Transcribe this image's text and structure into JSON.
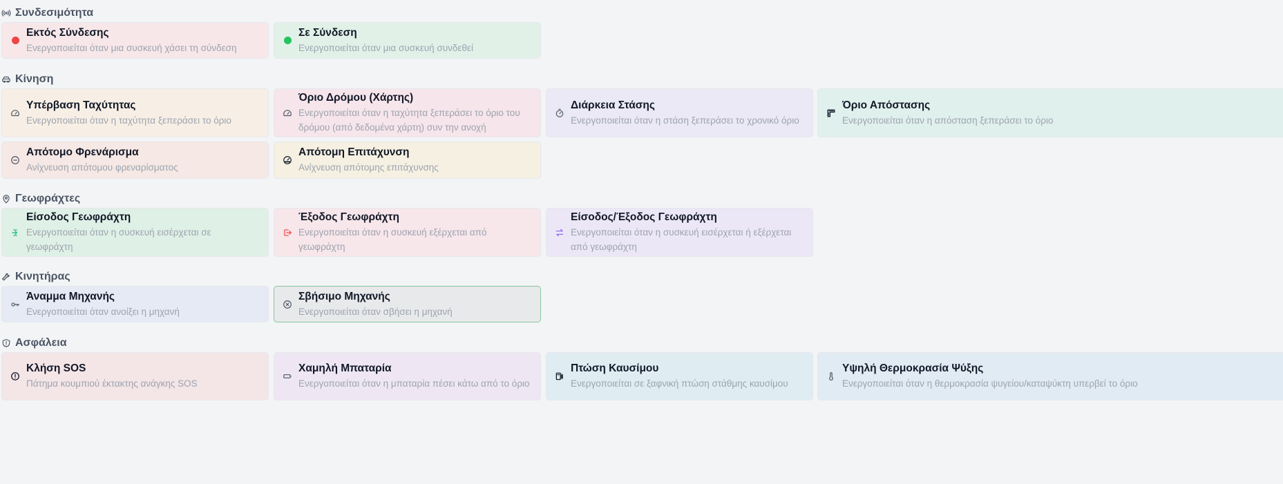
{
  "sections": [
    {
      "id": "connectivity",
      "title": "Συνδεσιμότητα",
      "icon": "signal-icon",
      "cards": [
        {
          "title": "Εκτός Σύνδεσης",
          "desc": "Ενεργοποιείται όταν μια συσκευή χάσει τη σύνδεση",
          "icon": "offline-dot-icon",
          "color": "#ef4444"
        },
        {
          "title": "Σε Σύνδεση",
          "desc": "Ενεργοποιείται όταν μια συσκευή συνδεθεί",
          "icon": "online-dot-icon",
          "color": "#22c55e"
        }
      ]
    },
    {
      "id": "motion",
      "title": "Κίνηση",
      "icon": "car-icon",
      "cards": [
        {
          "title": "Υπέρβαση Ταχύτητας",
          "desc": "Ενεργοποιείται όταν η ταχύτητα ξεπεράσει το όριο",
          "icon": "speedometer-icon"
        },
        {
          "title": "Όριο Δρόμου (Χάρτης)",
          "desc": "Ενεργοποιείται όταν η ταχύτητα ξεπεράσει το όριο του δρόμου (από δεδομένα χάρτη) συν την ανοχή",
          "icon": "speedometer-icon"
        },
        {
          "title": "Διάρκεια Στάσης",
          "desc": "Ενεργοποιείται όταν η στάση ξεπεράσει το χρονικό όριο",
          "icon": "stopwatch-icon"
        },
        {
          "title": "Όριο Απόστασης",
          "desc": "Ενεργοποιείται όταν η απόσταση ξεπεράσει το όριο",
          "icon": "ruler-icon"
        },
        {
          "title": "Απότομο Φρενάρισμα",
          "desc": "Ανίχνευση απότομου φρεναρίσματος",
          "icon": "brake-icon"
        },
        {
          "title": "Απότομη Επιτάχυνση",
          "desc": "Ανίχνευση απότομης επιτάχυνσης",
          "icon": "gauge-icon"
        }
      ]
    },
    {
      "id": "geofences",
      "title": "Γεωφράχτες",
      "icon": "map-pin-icon",
      "cards": [
        {
          "title": "Είσοδος Γεωφράχτη",
          "desc": "Ενεργοποιείται όταν η συσκευή εισέρχεται σε γεωφράχτη",
          "icon": "enter-icon",
          "color": "#10b981"
        },
        {
          "title": "Έξοδος Γεωφράχτη",
          "desc": "Ενεργοποιείται όταν η συσκευή εξέρχεται από γεωφράχτη",
          "icon": "exit-icon",
          "color": "#ef4444"
        },
        {
          "title": "Είσοδος/Έξοδος Γεωφράχτη",
          "desc": "Ενεργοποιείται όταν η συσκευή εισέρχεται ή εξέρχεται από γεωφράχτη",
          "icon": "swap-arrows-icon",
          "color": "#8b5cf6"
        }
      ]
    },
    {
      "id": "engine",
      "title": "Κινητήρας",
      "icon": "wrench-icon",
      "cards": [
        {
          "title": "Άναμμα Μηχανής",
          "desc": "Ενεργοποιείται όταν ανοίξει η μηχανή",
          "icon": "key-icon"
        },
        {
          "title": "Σβήσιμο Μηχανής",
          "desc": "Ενεργοποιείται όταν σβήσει η μηχανή",
          "icon": "power-off-icon"
        }
      ]
    },
    {
      "id": "safety",
      "title": "Ασφάλεια",
      "icon": "shield-icon",
      "cards": [
        {
          "title": "Κλήση SOS",
          "desc": "Πάτημα κουμπιού έκτακτης ανάγκης SOS",
          "icon": "alert-circle-icon"
        },
        {
          "title": "Χαμηλή Μπαταρία",
          "desc": "Ενεργοποιείται όταν η μπαταρία πέσει κάτω από το όριο",
          "icon": "battery-icon"
        },
        {
          "title": "Πτώση Καυσίμου",
          "desc": "Ενεργοποιείται σε ξαφνική πτώση στάθμης καυσίμου",
          "icon": "fuel-icon"
        },
        {
          "title": "Υψηλή Θερμοκρασία Ψύξης",
          "desc": "Ενεργοποιείται όταν η θερμοκρασία ψυγείου/καταψύκτη υπερβεί το όριο",
          "icon": "thermometer-icon"
        }
      ]
    }
  ]
}
